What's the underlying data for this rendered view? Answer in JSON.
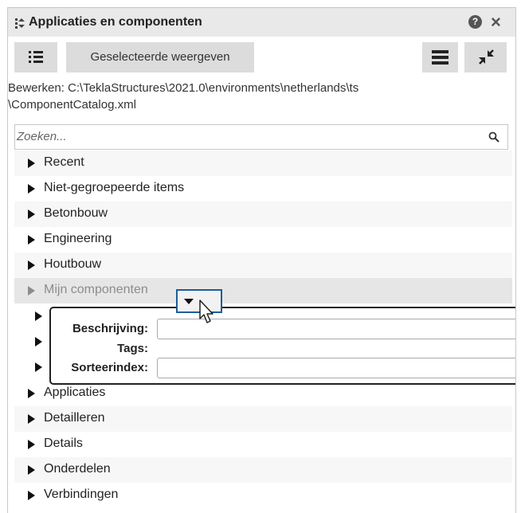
{
  "window": {
    "title": "Applicaties en componenten",
    "help_icon": "?",
    "close_icon": "×"
  },
  "toolbar": {
    "list_icon": "list-view-icon",
    "show_selected_label": "Geselecteerde weergeven",
    "menu_icon": "menu-icon",
    "collapse_icon": "collapse-icon"
  },
  "edit_path": {
    "line1": "Bewerken:  C:\\TeklaStructures\\2021.0\\environments\\netherlands\\ts",
    "line2": "\\ComponentCatalog.xml"
  },
  "search": {
    "placeholder": "Zoeken..."
  },
  "tree": {
    "items": [
      {
        "label": "Recent"
      },
      {
        "label": "Niet-gegroepeerde items"
      },
      {
        "label": "Betonbouw"
      },
      {
        "label": "Engineering"
      },
      {
        "label": "Houtbouw"
      },
      {
        "label": "Mijn componenten"
      },
      {
        "label": "Applicaties"
      },
      {
        "label": "Detailleren"
      },
      {
        "label": "Details"
      },
      {
        "label": "Onderdelen"
      },
      {
        "label": "Verbindingen"
      }
    ]
  },
  "popup": {
    "description_label": "Beschrijving:",
    "tags_label": "Tags:",
    "sort_label": "Sorteerindex:"
  },
  "colors": {
    "highlight_border": "#1f5c99",
    "titlebar_bg": "#e9e9e9",
    "button_bg": "#dcdcdc"
  }
}
